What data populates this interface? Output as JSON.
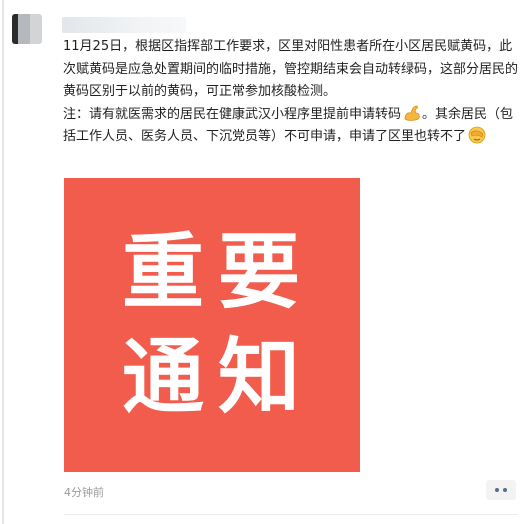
{
  "post": {
    "paragraph_1": "11月25日，根据区指挥部工作要求，区里对阳性患者所在小区居民赋黄码，此次赋黄码是应急处置期间的临时措施，管控期结束会自动转绿码，这部分居民的黄码区别于以前的黄码，可正常参加核酸检测。",
    "note_part_1": "注：请有就医需求的居民在健康武汉小程序里提前申请转码",
    "emoji_1": "strong-arm-emoji",
    "note_part_2": "。其余居民（包括工作人员、医务人员、下沉党员等）不可申请，申请了区里也转不了",
    "emoji_2": "facepalm-emoji",
    "image": {
      "char_1": "重",
      "char_2": "要",
      "char_3": "通",
      "char_4": "知",
      "background_color": "#f25c4c",
      "text_color": "#ffffff"
    },
    "timestamp": "4分钟前"
  },
  "more_button": {
    "icon": "more-dots-icon"
  }
}
